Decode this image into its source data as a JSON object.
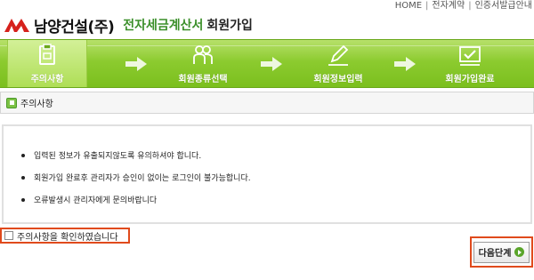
{
  "top_links": [
    "HOME",
    "전자계약",
    "인증서발급안내"
  ],
  "header": {
    "company": "남양건설(주)",
    "service": "전자세금계산서",
    "page": "회원가입"
  },
  "steps": [
    {
      "label": "주의사항",
      "icon": "document-icon",
      "active": true
    },
    {
      "label": "회원종류선택",
      "icon": "users-icon",
      "active": false
    },
    {
      "label": "회원정보입력",
      "icon": "pen-icon",
      "active": false
    },
    {
      "label": "회원가입완료",
      "icon": "check-icon",
      "active": false
    }
  ],
  "section": {
    "title": "주의사항"
  },
  "notices": [
    "입력된 정보가 유출되지않도록 유의하셔야 합니다.",
    "회원가입 완료후 관리자가 승인이 없이는 로그인이 불가능합니다.",
    "오류발생시 관리자에게 문의바랍니다"
  ],
  "confirm": {
    "label": "주의사항을 확인하였습니다",
    "checked": false
  },
  "next_button": {
    "label": "다음단계"
  },
  "colors": {
    "accent": "#8ccb2f",
    "highlight": "#e04a1c"
  }
}
